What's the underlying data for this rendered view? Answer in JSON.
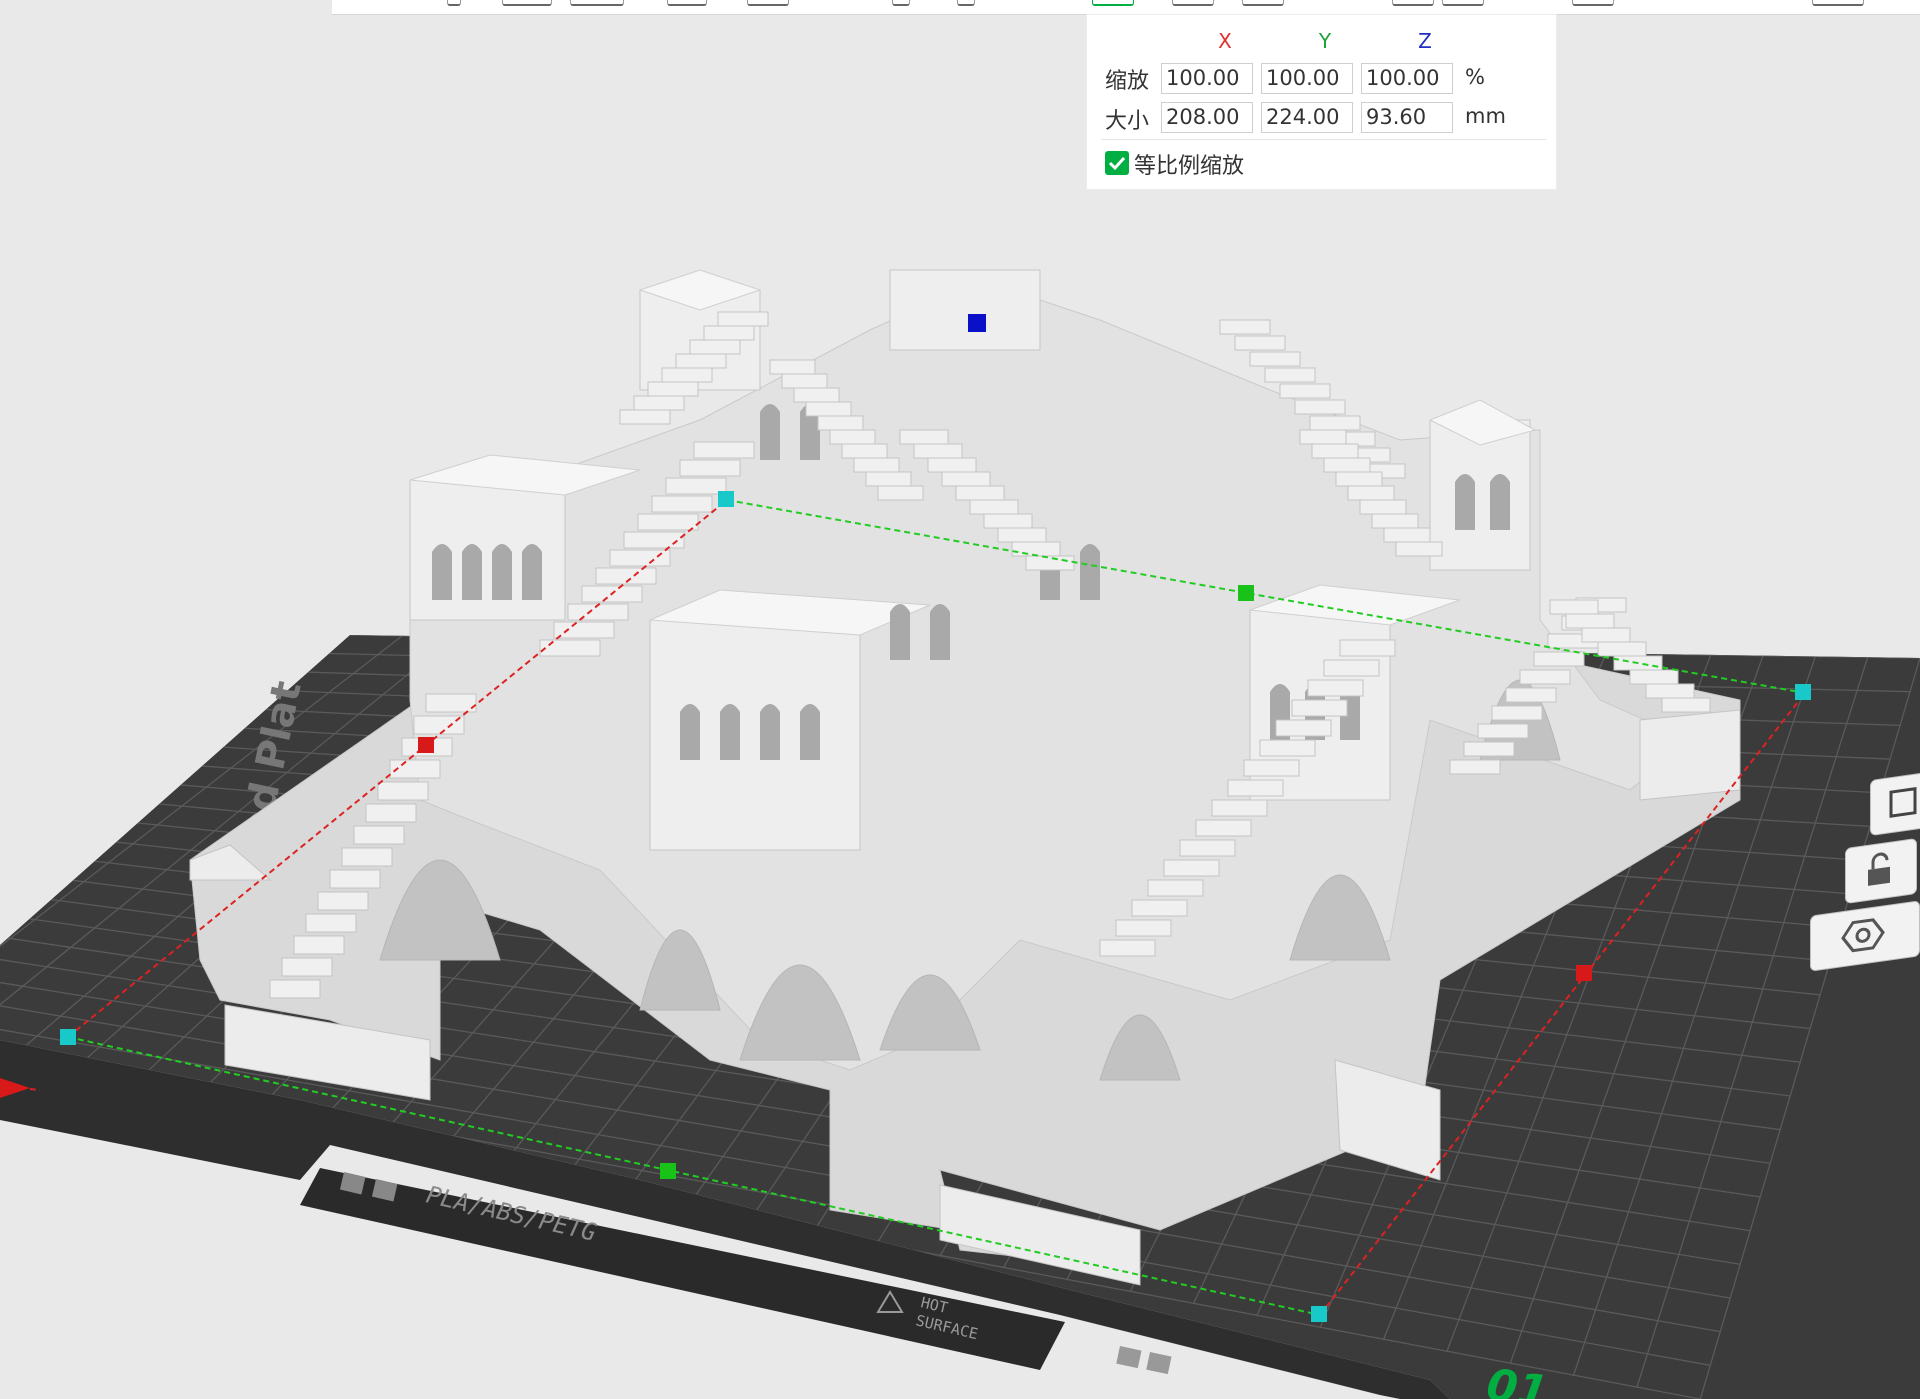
{
  "scale_panel": {
    "axes": {
      "x": "X",
      "y": "Y",
      "z": "Z"
    },
    "axis_colors": {
      "x": "#e03030",
      "y": "#1ea03a",
      "z": "#2030c0"
    },
    "scale_label": "缩放",
    "size_label": "大小",
    "scale_values": {
      "x": "100.00",
      "y": "100.00",
      "z": "100.00"
    },
    "scale_unit": "%",
    "size_values": {
      "x": "208.00",
      "y": "224.00",
      "z": "93.60"
    },
    "size_unit": "mm",
    "uniform_scale_label": "等比例缩放",
    "uniform_scale_checked": true
  },
  "build_plate": {
    "material_text": "PLA/ABS/PETG",
    "warning_text_1": "HOT",
    "warning_text_2": "SURFACE",
    "plate_number": "01",
    "brand_text": "ed Plat",
    "plate_color": "#3b3b3b",
    "grid_color": "#595959"
  },
  "model": {
    "color": "#e2e2e2"
  },
  "gizmo": {
    "x_handle_color": "#d81919",
    "y_handle_color": "#19c219",
    "z_handle_color": "#0a10c8",
    "corner_handle_color": "#19c8c8"
  },
  "side_toolbar": [
    "layers-icon",
    "lock-icon",
    "hexagon-icon"
  ]
}
